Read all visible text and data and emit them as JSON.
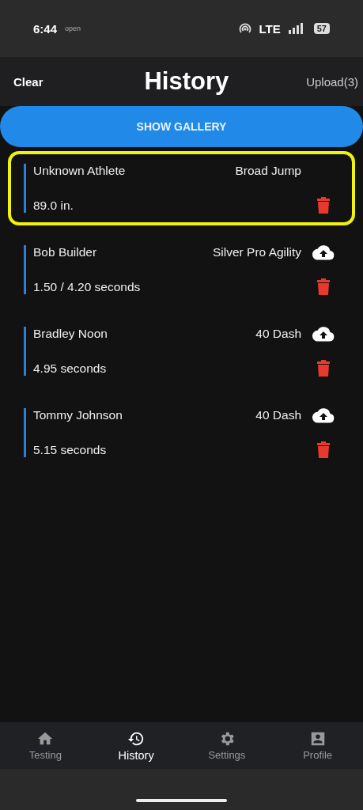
{
  "status_bar": {
    "time": "6:44",
    "note": "open",
    "network": "LTE",
    "battery": "57"
  },
  "header": {
    "left_action": "Clear",
    "title": "History",
    "right_action": "Upload(3)"
  },
  "gallery_button": "SHOW GALLERY",
  "results": [
    {
      "athlete": "Unknown Athlete",
      "test": "Broad Jump",
      "result": "89.0 in.",
      "selected": true,
      "pending_upload": false
    },
    {
      "athlete": "Bob Builder",
      "test": "Silver Pro Agility",
      "result": "1.50 / 4.20 seconds",
      "selected": false,
      "pending_upload": true
    },
    {
      "athlete": "Bradley Noon",
      "test": "40 Dash",
      "result": "4.95 seconds",
      "selected": false,
      "pending_upload": true
    },
    {
      "athlete": "Tommy Johnson",
      "test": "40 Dash",
      "result": "5.15 seconds",
      "selected": false,
      "pending_upload": true
    }
  ],
  "tab_bar": [
    {
      "kind": "home",
      "label": "Testing",
      "selected": false
    },
    {
      "kind": "history",
      "label": "History",
      "selected": true
    },
    {
      "kind": "settings",
      "label": "Settings",
      "selected": false
    },
    {
      "kind": "profile",
      "label": "Profile",
      "selected": false
    }
  ]
}
